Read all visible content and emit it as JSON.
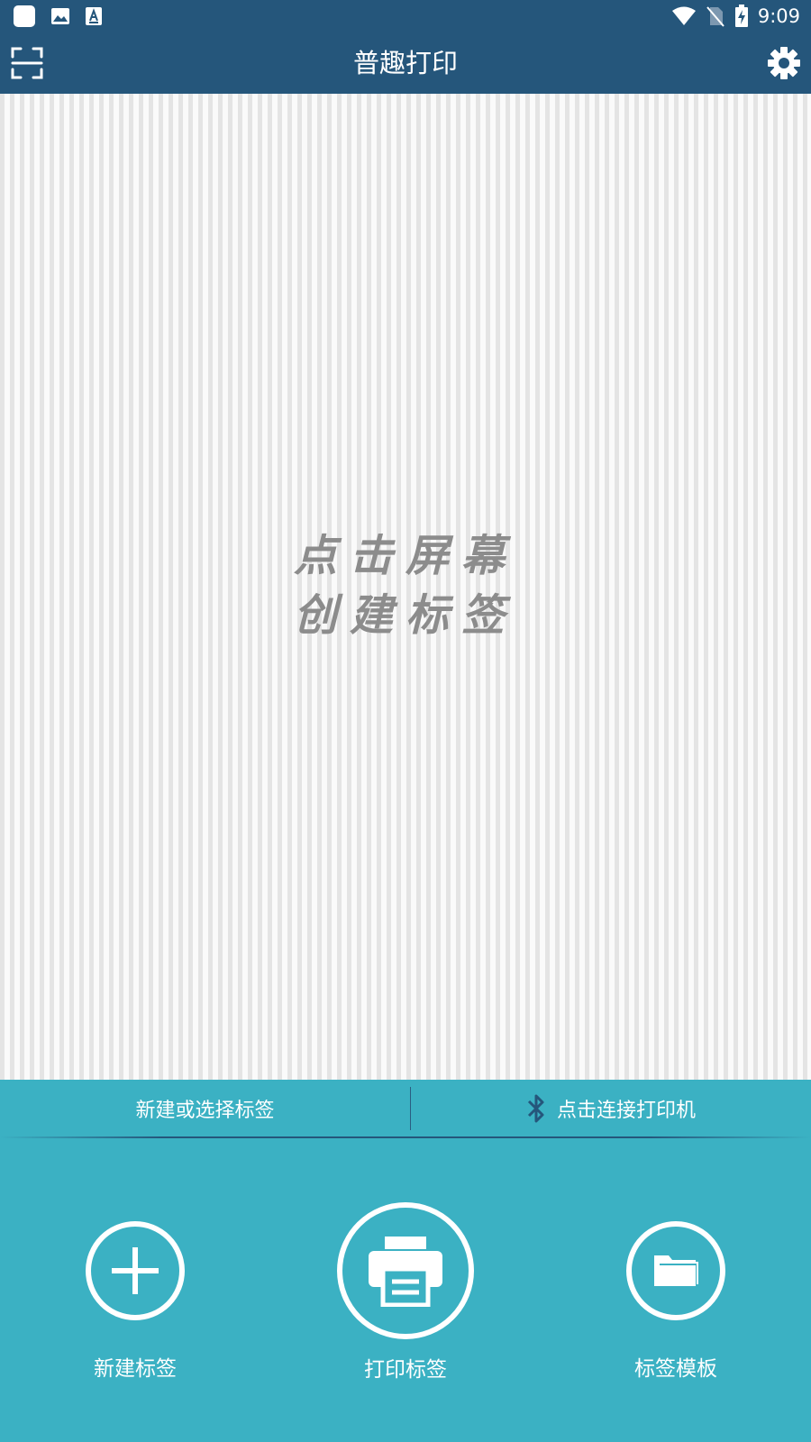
{
  "status_bar": {
    "time": "9:09",
    "left_icons": [
      "app-icon",
      "image-icon",
      "font-icon"
    ],
    "right_icons": [
      "wifi-icon",
      "no-sim-icon",
      "battery-charging-icon"
    ]
  },
  "app_bar": {
    "title": "普趣打印",
    "left_icon": "scan-icon",
    "right_icon": "gear-icon"
  },
  "canvas": {
    "hint_line1": "点击屏幕",
    "hint_line2": "创建标签"
  },
  "panel": {
    "new_or_select_label": "新建或选择标签",
    "connect_printer_label": "点击连接打印机",
    "actions": [
      {
        "label": "新建标签",
        "icon": "plus-icon"
      },
      {
        "label": "打印标签",
        "icon": "printer-icon"
      },
      {
        "label": "标签模板",
        "icon": "folder-icon"
      }
    ]
  },
  "colors": {
    "header": "#25567b",
    "panel": "#3bb1c3",
    "stripe_dark": "#e4e4e4",
    "stripe_light": "#fafafa",
    "hint_text": "#8c8c8c"
  }
}
